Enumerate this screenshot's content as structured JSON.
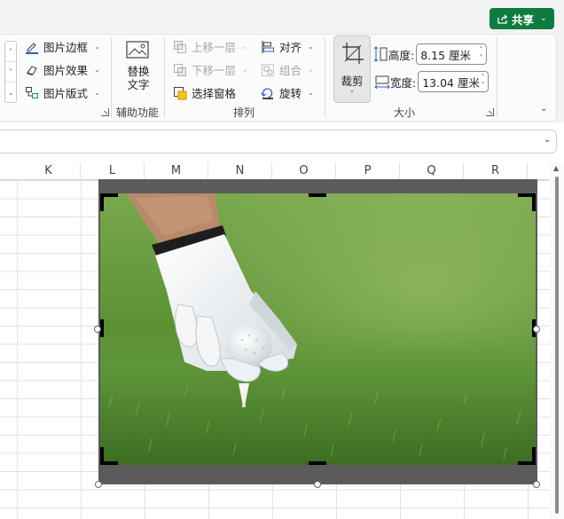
{
  "ribbon": {
    "share": {
      "label": "共享",
      "icon": "share-icon"
    },
    "picture_styles": {
      "border": "图片边框",
      "effects": "图片效果",
      "layout": "图片版式"
    },
    "accessibility": {
      "alt_text_line1": "替换",
      "alt_text_line2": "文字",
      "group_label": "辅助功能"
    },
    "arrange": {
      "bring_forward": "上移一层",
      "send_backward": "下移一层",
      "selection_pane": "选择窗格",
      "align": "对齐",
      "group": "组合",
      "rotate": "旋转",
      "group_label": "排列"
    },
    "size": {
      "crop": "裁剪",
      "height_label": "高度:",
      "height_value": "8.15 厘米",
      "width_label": "宽度:",
      "width_value": "13.04 厘米",
      "group_label": "大小"
    }
  },
  "sheet": {
    "columns": [
      "K",
      "L",
      "M",
      "N",
      "O",
      "P",
      "Q",
      "R"
    ]
  },
  "colors": {
    "accent": "#0f7b3f",
    "crop_mask": "#5b5b5b",
    "grass": "#4e8a2c"
  }
}
